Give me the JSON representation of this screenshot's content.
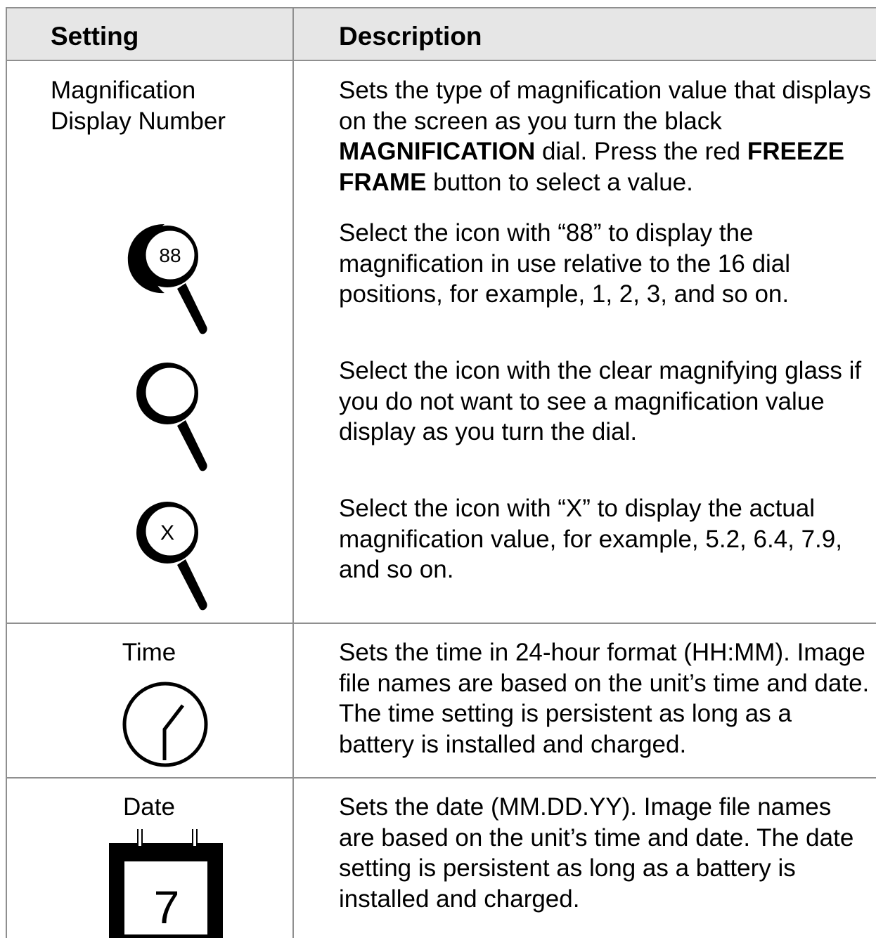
{
  "header": {
    "setting": "Setting",
    "description": "Description"
  },
  "rows": {
    "magnification": {
      "setting_line1": "Magnification",
      "setting_line2": "Display Number",
      "desc": {
        "p1_a": "Sets the type of magnification value that displays on the screen as you turn the black ",
        "p1_b": "MAGNIFICATION",
        "p1_c": " dial. Press the red ",
        "p1_d": "FREEZE FRAME",
        "p1_e": " button to select a value.",
        "p2": "Select the icon with “88” to display the magnification in use relative to the 16 dial positions, for example, 1, 2, 3, and so on.",
        "p3": "Select the icon with the clear magnifying glass if you do not want to see a magnification value display as you turn the dial.",
        "p4": "Select the icon with “X” to display the actual magnification value, for example, 5.2, 6.4, 7.9, and so on."
      },
      "icons": [
        {
          "name": "magnifier-88-icon",
          "label": "88"
        },
        {
          "name": "magnifier-clear-icon",
          "label": ""
        },
        {
          "name": "magnifier-x-icon",
          "label": "X"
        }
      ]
    },
    "time": {
      "setting": "Time",
      "desc": "Sets the time in 24-hour format (HH:MM). Image file names are based on the unit’s time and date. The time setting is persistent as long as a battery is installed and charged.",
      "icon": "clock-icon"
    },
    "date": {
      "setting": "Date",
      "desc": "Sets the date (MM.DD.YY). Image file names are based on the unit’s time and date. The date setting is persistent as long as a battery is installed and charged.",
      "icon": "calendar-icon",
      "icon_number": "7"
    }
  }
}
